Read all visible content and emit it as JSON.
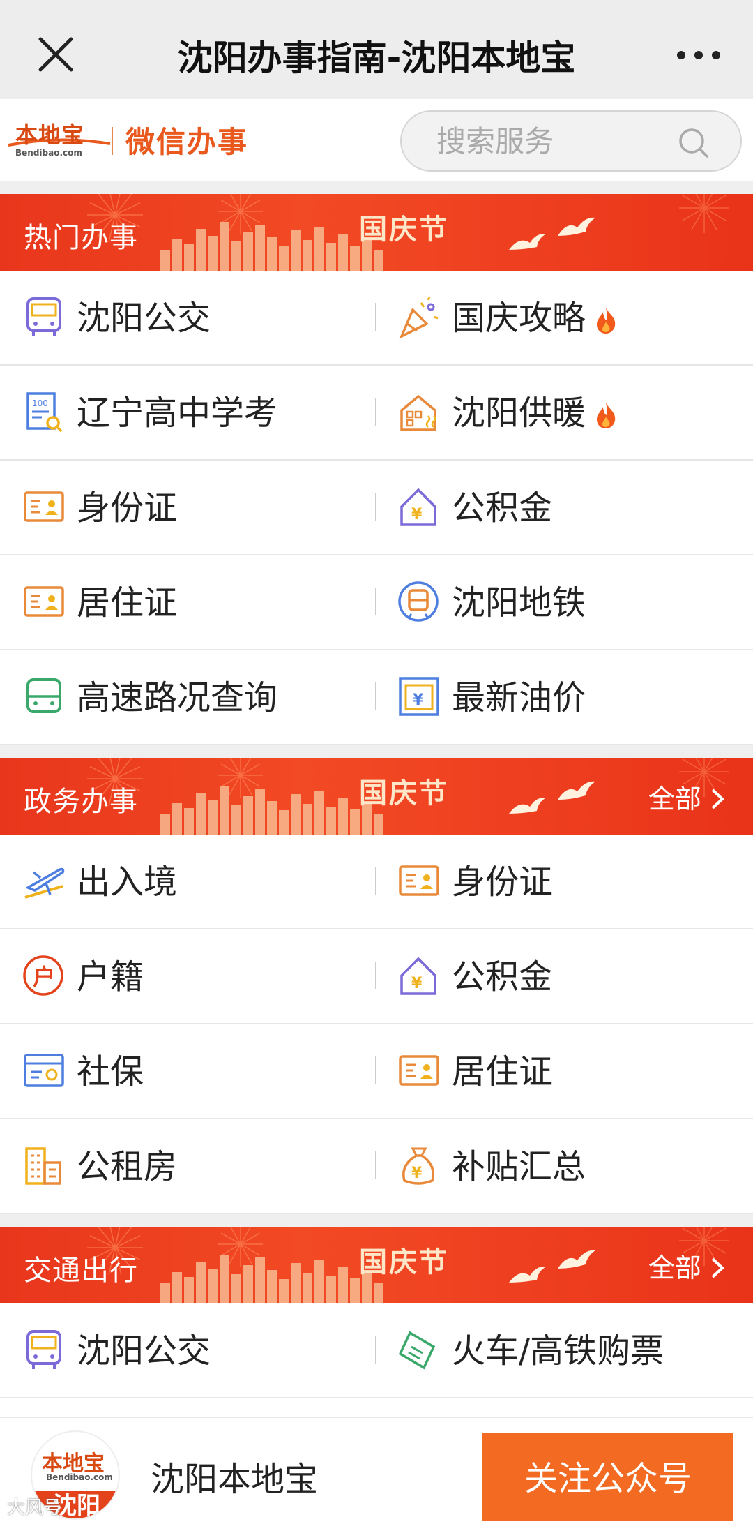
{
  "titlebar": {
    "title": "沈阳办事指南-沈阳本地宝"
  },
  "header": {
    "logo_text": "本地宝",
    "logo_sub": "Bendibao.com",
    "wechat": "微信办事",
    "search_placeholder": "搜索服务"
  },
  "sections": [
    {
      "title": "热门办事",
      "holiday": "国庆节",
      "more": "",
      "rows": [
        [
          {
            "label": "沈阳公交",
            "icon": "bus-icon",
            "hot": false
          },
          {
            "label": "国庆攻略",
            "icon": "party-icon",
            "hot": true
          }
        ],
        [
          {
            "label": "辽宁高中学考",
            "icon": "exam-icon",
            "hot": false
          },
          {
            "label": "沈阳供暖",
            "icon": "heating-icon",
            "hot": true
          }
        ],
        [
          {
            "label": "身份证",
            "icon": "id-card-icon",
            "hot": false
          },
          {
            "label": "公积金",
            "icon": "fund-house-icon",
            "hot": false
          }
        ],
        [
          {
            "label": "居住证",
            "icon": "id-card-icon",
            "hot": false
          },
          {
            "label": "沈阳地铁",
            "icon": "metro-icon",
            "hot": false
          }
        ],
        [
          {
            "label": "高速路况查询",
            "icon": "highway-icon",
            "hot": false
          },
          {
            "label": "最新油价",
            "icon": "oil-price-icon",
            "hot": false
          }
        ]
      ]
    },
    {
      "title": "政务办事",
      "holiday": "国庆节",
      "more": "全部",
      "rows": [
        [
          {
            "label": "出入境",
            "icon": "plane-icon",
            "hot": false
          },
          {
            "label": "身份证",
            "icon": "id-card-icon",
            "hot": false
          }
        ],
        [
          {
            "label": "户籍",
            "icon": "household-icon",
            "hot": false
          },
          {
            "label": "公积金",
            "icon": "fund-house-icon",
            "hot": false
          }
        ],
        [
          {
            "label": "社保",
            "icon": "social-card-icon",
            "hot": false
          },
          {
            "label": "居住证",
            "icon": "id-card-icon",
            "hot": false
          }
        ],
        [
          {
            "label": "公租房",
            "icon": "building-icon",
            "hot": false
          },
          {
            "label": "补贴汇总",
            "icon": "money-bag-icon",
            "hot": false
          }
        ]
      ]
    },
    {
      "title": "交通出行",
      "holiday": "国庆节",
      "more": "全部",
      "rows": [
        [
          {
            "label": "沈阳公交",
            "icon": "bus-icon",
            "hot": false
          },
          {
            "label": "火车/高铁购票",
            "icon": "ticket-icon",
            "hot": false
          }
        ]
      ]
    }
  ],
  "footer": {
    "avatar_top": "本地宝",
    "avatar_sub": "Bendibao.com",
    "avatar_bottom": "沈阳",
    "name": "沈阳本地宝",
    "follow": "关注公众号"
  },
  "watermark": "大风号"
}
